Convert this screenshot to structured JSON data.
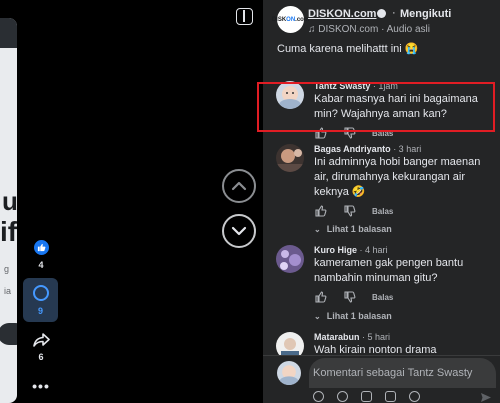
{
  "left_video": {
    "prev_text": [
      "u",
      "if",
      "g",
      "ia"
    ],
    "actions": {
      "like_count": "4",
      "comment_count": "9",
      "share_count": "6",
      "more_label": "•••"
    }
  },
  "post": {
    "page_name": "DISKON.com",
    "follow_separator": "·",
    "follow_label": "Mengikuti",
    "audio_label": "DISKON.com · Audio asli",
    "avatar_text_a": "DISK",
    "avatar_text_b": "ON",
    "avatar_text_c": ".com",
    "caption": "Cuma karena melihattt ini 😭"
  },
  "comments": [
    {
      "name": "Tantz Swasty",
      "time": " · 1jam",
      "text": "Kabar masnya hari ini bagaimana min? Wajahnya aman kan?",
      "reply_label": "Balas"
    },
    {
      "name": "Bagas Andriyanto",
      "time": " · 3 hari",
      "text": "Ini adminnya hobi banger maenan air, dirumahnya kekurangan air keknya 🤣",
      "reply_label": "Balas",
      "replies": "Lihat 1 balasan"
    },
    {
      "name": "Kuro Hige",
      "time": " · 4 hari",
      "text": "kameramen gak pengen bantu nambahin minuman gitu?",
      "reply_label": "Balas",
      "replies": "Lihat 1 balasan"
    },
    {
      "name": "Matarabun",
      "time": " · 5 hari",
      "text": "Wah kirain nonton drama"
    }
  ],
  "composer": {
    "placeholder": "Komentari sebagai Tantz Swasty"
  },
  "colors": {
    "panel_bg": "#242526",
    "accent_blue": "#1877f2",
    "highlight_red": "#e11d24"
  },
  "icons": [
    "toggle-panel-icon",
    "chevron-up-icon",
    "chevron-down-icon",
    "like-icon",
    "comment-icon",
    "share-icon",
    "more-icon",
    "globe-icon",
    "music-note-icon",
    "thumbs-up-icon",
    "thumbs-down-icon",
    "sticker-icon",
    "emoji-icon",
    "camera-icon",
    "gif-icon",
    "send-icon"
  ]
}
